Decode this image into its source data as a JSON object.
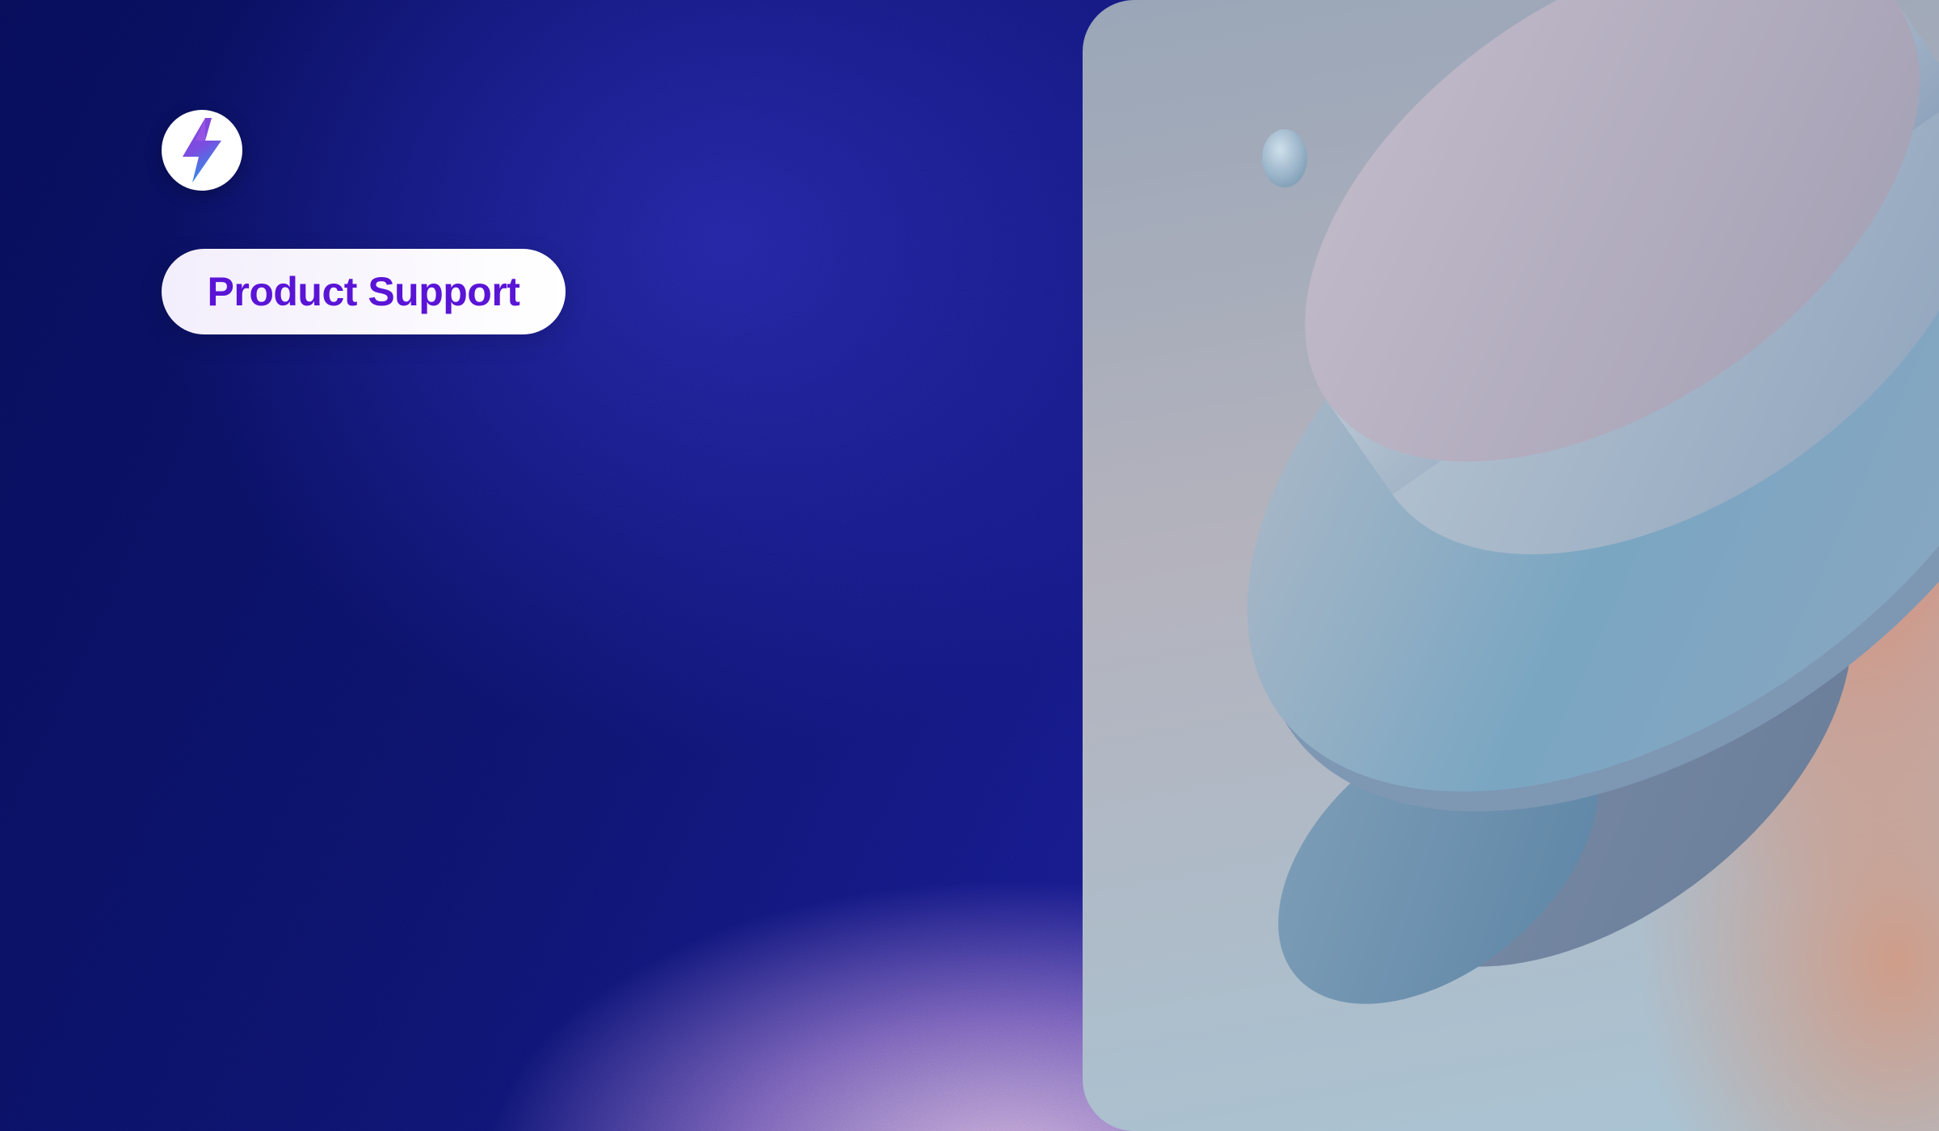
{
  "brand": {
    "logo_icon": "lightning-bolt-icon",
    "colors": {
      "bolt_purple": "#7b3fe4",
      "bolt_blue": "#2f7fe0"
    }
  },
  "tag": {
    "label": "Product Support",
    "text_color": "#5a14d6"
  },
  "artwork": {
    "icon": "abstract-3d-discs-illustration"
  },
  "colors": {
    "background": "#0f1670",
    "glow": "#d6b6dc"
  }
}
